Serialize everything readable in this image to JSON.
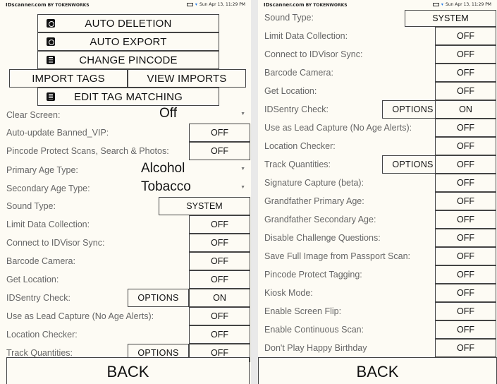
{
  "status_bar": {
    "brand_main": "IDscanner.com",
    "brand_sub": "BY TOKENWORKS",
    "datetime_left": "Sun Apr 13, 11:29 PM",
    "datetime_right": "Sun Apr 13, 11:29 PM"
  },
  "left": {
    "buttons": {
      "auto_deletion": "AUTO DELETION",
      "auto_export": "AUTO EXPORT",
      "change_pincode": "CHANGE PINCODE",
      "import_tags": "IMPORT TAGS",
      "view_imports": "VIEW IMPORTS",
      "edit_tag_matching": "EDIT TAG MATCHING"
    },
    "spinners": {
      "clear_screen": {
        "label": "Clear Screen:",
        "value": "Off"
      },
      "primary_age": {
        "label": "Primary Age Type:",
        "value": "Alcohol"
      },
      "secondary_age": {
        "label": "Secondary Age Type:",
        "value": "Tobacco"
      }
    },
    "settings": [
      {
        "label": "Auto-update Banned_VIP:",
        "value": "OFF"
      },
      {
        "label": "Pincode Protect Scans, Search & Photos:",
        "value": "OFF"
      },
      {
        "label": "Sound Type:",
        "value": "SYSTEM"
      },
      {
        "label": "Limit Data Collection:",
        "value": "OFF"
      },
      {
        "label": "Connect to IDVisor Sync:",
        "value": "OFF"
      },
      {
        "label": "Barcode Camera:",
        "value": "OFF"
      },
      {
        "label": "Get Location:",
        "value": "OFF"
      },
      {
        "label": "IDSentry Check:",
        "value": "ON",
        "options": "OPTIONS"
      },
      {
        "label": "Use as Lead Capture (No Age Alerts):",
        "value": "OFF"
      },
      {
        "label": "Location Checker:",
        "value": "OFF"
      },
      {
        "label": "Track Quantities:",
        "value": "OFF",
        "options": "OPTIONS"
      }
    ],
    "back": "BACK"
  },
  "right": {
    "settings": [
      {
        "label": "Sound Type:",
        "value": "SYSTEM"
      },
      {
        "label": "Limit Data Collection:",
        "value": "OFF"
      },
      {
        "label": "Connect to IDVisor Sync:",
        "value": "OFF"
      },
      {
        "label": "Barcode Camera:",
        "value": "OFF"
      },
      {
        "label": "Get Location:",
        "value": "OFF"
      },
      {
        "label": "IDSentry Check:",
        "value": "ON",
        "options": "OPTIONS"
      },
      {
        "label": "Use as Lead Capture (No Age Alerts):",
        "value": "OFF"
      },
      {
        "label": "Location Checker:",
        "value": "OFF"
      },
      {
        "label": "Track Quantities:",
        "value": "OFF",
        "options": "OPTIONS"
      },
      {
        "label": "Signature Capture (beta):",
        "value": "OFF"
      },
      {
        "label": "Grandfather Primary Age:",
        "value": "OFF"
      },
      {
        "label": "Grandfather Secondary Age:",
        "value": "OFF"
      },
      {
        "label": "Disable Challenge Questions:",
        "value": "OFF"
      },
      {
        "label": "Save Full Image from Passport Scan:",
        "value": "OFF"
      },
      {
        "label": "Pincode Protect Tagging:",
        "value": "OFF"
      },
      {
        "label": "Kiosk Mode:",
        "value": "OFF"
      },
      {
        "label": "Enable Screen Flip:",
        "value": "OFF"
      },
      {
        "label": "Enable Continuous Scan:",
        "value": "OFF"
      },
      {
        "label": "Don't Play Happy Birthday",
        "value": "OFF"
      }
    ],
    "back": "BACK"
  }
}
